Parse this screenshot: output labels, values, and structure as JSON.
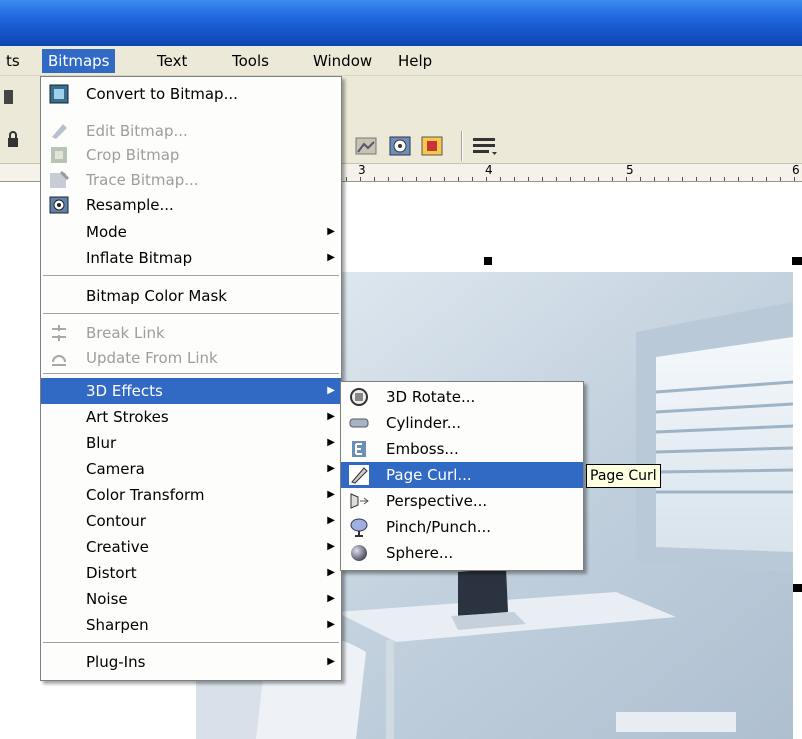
{
  "menubar": {
    "items": [
      {
        "label": "ts"
      },
      {
        "label": "Bitmaps"
      },
      {
        "label": "Text"
      },
      {
        "label": "Tools"
      },
      {
        "label": "Window"
      },
      {
        "label": "Help"
      }
    ]
  },
  "ruler": {
    "labels": [
      "3",
      "4",
      "5",
      "6"
    ]
  },
  "bitmaps_menu": {
    "items": [
      {
        "label": "Convert to Bitmap...",
        "icon": "convert-bitmap-icon",
        "enabled": true
      },
      {
        "label": "Edit Bitmap...",
        "icon": "edit-bitmap-icon",
        "enabled": false
      },
      {
        "label": "Crop Bitmap",
        "icon": "crop-bitmap-icon",
        "enabled": false
      },
      {
        "label": "Trace Bitmap...",
        "icon": "trace-bitmap-icon",
        "enabled": false
      },
      {
        "label": "Resample...",
        "icon": "resample-icon",
        "enabled": true
      },
      {
        "label": "Mode",
        "submenu": true,
        "enabled": true
      },
      {
        "label": "Inflate Bitmap",
        "submenu": true,
        "enabled": true
      },
      {
        "label": "Bitmap Color Mask",
        "enabled": true
      },
      {
        "label": "Break Link",
        "icon": "break-link-icon",
        "enabled": false
      },
      {
        "label": "Update From Link",
        "icon": "update-link-icon",
        "enabled": false
      },
      {
        "label": "3D Effects",
        "submenu": true,
        "highlighted": true
      },
      {
        "label": "Art Strokes",
        "submenu": true
      },
      {
        "label": "Blur",
        "submenu": true
      },
      {
        "label": "Camera",
        "submenu": true
      },
      {
        "label": "Color Transform",
        "submenu": true
      },
      {
        "label": "Contour",
        "submenu": true
      },
      {
        "label": "Creative",
        "submenu": true
      },
      {
        "label": "Distort",
        "submenu": true
      },
      {
        "label": "Noise",
        "submenu": true
      },
      {
        "label": "Sharpen",
        "submenu": true
      },
      {
        "label": "Plug-Ins",
        "submenu": true
      }
    ]
  },
  "effects_submenu": {
    "items": [
      {
        "label": "3D Rotate...",
        "icon": "3d-rotate-icon"
      },
      {
        "label": "Cylinder...",
        "icon": "cylinder-icon"
      },
      {
        "label": "Emboss...",
        "icon": "emboss-icon"
      },
      {
        "label": "Page Curl...",
        "icon": "page-curl-icon",
        "highlighted": true
      },
      {
        "label": "Perspective...",
        "icon": "perspective-icon"
      },
      {
        "label": "Pinch/Punch...",
        "icon": "pinch-punch-icon"
      },
      {
        "label": "Sphere...",
        "icon": "sphere-icon"
      }
    ]
  },
  "tooltip": {
    "text": "Page Curl"
  },
  "colors": {
    "highlight": "#316ac5",
    "titlebar": "#1f66dd",
    "menubar": "#ece9d8"
  }
}
